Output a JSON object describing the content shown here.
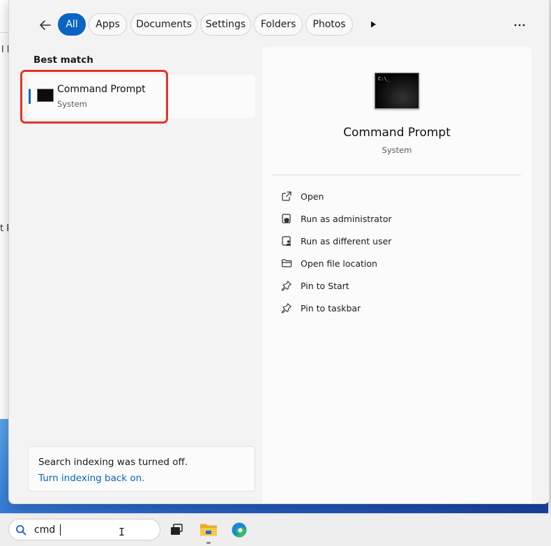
{
  "background": {
    "fragment_1": "l D",
    "fragment_2": "t P"
  },
  "search_panel": {
    "filters": [
      {
        "label": "All",
        "active": true
      },
      {
        "label": "Apps",
        "active": false
      },
      {
        "label": "Documents",
        "active": false
      },
      {
        "label": "Settings",
        "active": false
      },
      {
        "label": "Folders",
        "active": false
      },
      {
        "label": "Photos",
        "active": false
      }
    ],
    "best_match_heading": "Best match",
    "result": {
      "name": "Command Prompt",
      "type": "System"
    },
    "indexing": {
      "message": "Search indexing was turned off.",
      "link": "Turn indexing back on."
    }
  },
  "preview": {
    "title": "Command Prompt",
    "subtitle": "System",
    "actions": [
      {
        "label": "Open",
        "icon": "open-external-icon"
      },
      {
        "label": "Run as administrator",
        "icon": "shield-admin-icon"
      },
      {
        "label": "Run as different user",
        "icon": "user-switch-icon"
      },
      {
        "label": "Open file location",
        "icon": "folder-icon"
      },
      {
        "label": "Pin to Start",
        "icon": "pin-icon"
      },
      {
        "label": "Pin to taskbar",
        "icon": "pin-icon"
      }
    ]
  },
  "taskbar": {
    "search_value": "cmd",
    "apps": [
      "task-view-icon",
      "file-explorer-icon",
      "edge-icon"
    ]
  },
  "colors": {
    "accent": "#0a64c4",
    "highlight": "#e0352a"
  }
}
